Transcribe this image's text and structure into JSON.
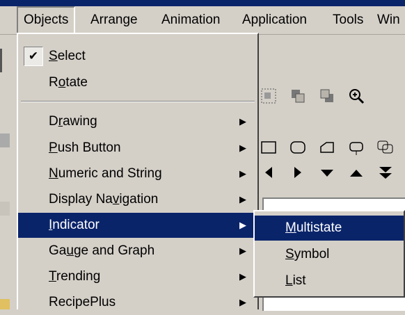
{
  "menubar": {
    "items": [
      "Objects",
      "Arrange",
      "Animation",
      "Application",
      "Tools",
      "Win"
    ],
    "active": "Objects"
  },
  "objects_menu": {
    "items": [
      {
        "label": "Select",
        "accel": "S",
        "checked": true,
        "submenu": false
      },
      {
        "label": "Rotate",
        "accel": "o",
        "checked": false,
        "submenu": false
      },
      {
        "label": "Drawing",
        "accel": "r",
        "checked": false,
        "submenu": true
      },
      {
        "label": "Push Button",
        "accel": "P",
        "checked": false,
        "submenu": true
      },
      {
        "label": "Numeric and  String",
        "accel": "N",
        "checked": false,
        "submenu": true
      },
      {
        "label": "Display Navigation",
        "accel": "v",
        "checked": false,
        "submenu": true
      },
      {
        "label": "Indicator",
        "accel": "I",
        "checked": false,
        "submenu": true,
        "highlighted": true
      },
      {
        "label": "Gauge and Graph",
        "accel": "u",
        "checked": false,
        "submenu": true
      },
      {
        "label": "Trending",
        "accel": "T",
        "checked": false,
        "submenu": true
      },
      {
        "label": "RecipePlus",
        "accel": "",
        "checked": false,
        "submenu": true
      }
    ]
  },
  "indicator_submenu": {
    "items": [
      {
        "label": "Multistate",
        "accel": "M",
        "highlighted": true
      },
      {
        "label": "Symbol",
        "accel": "S"
      },
      {
        "label": "List",
        "accel": "L"
      }
    ]
  },
  "colors": {
    "menu_bg": "#d4d0c8",
    "highlight": "#0a246a",
    "highlight_text": "#ffffff"
  },
  "icons": [
    "checkmark-icon",
    "submenu-arrow-icon",
    "group-icon",
    "front-icon",
    "back-icon",
    "zoom-icon",
    "rectangle-tool-icon",
    "rounded-rect-tool-icon",
    "polygon-tool-icon",
    "button-tool-icon",
    "arrow-left-icon",
    "arrow-right-icon",
    "arrow-down-icon",
    "arrow-up-icon",
    "double-arrow-down-icon"
  ]
}
